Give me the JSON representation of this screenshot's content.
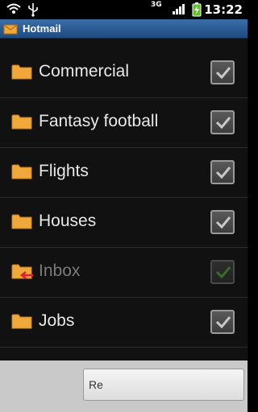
{
  "status": {
    "time": "13:22",
    "network": "3G"
  },
  "app": {
    "title": "Hotmail"
  },
  "folders": [
    {
      "label": "Commercial",
      "checked": true
    },
    {
      "label": "Fantasy football",
      "checked": true
    },
    {
      "label": "Flights",
      "checked": true
    },
    {
      "label": "Houses",
      "checked": true
    },
    {
      "label": "Inbox",
      "checked": true,
      "disabled": true
    },
    {
      "label": "Jobs",
      "checked": true
    }
  ],
  "bottom": {
    "button_label": "Re"
  },
  "colors": {
    "title_bar": "#2b5b93",
    "folder": "#f0a83a",
    "check": "#c8c8c8"
  }
}
